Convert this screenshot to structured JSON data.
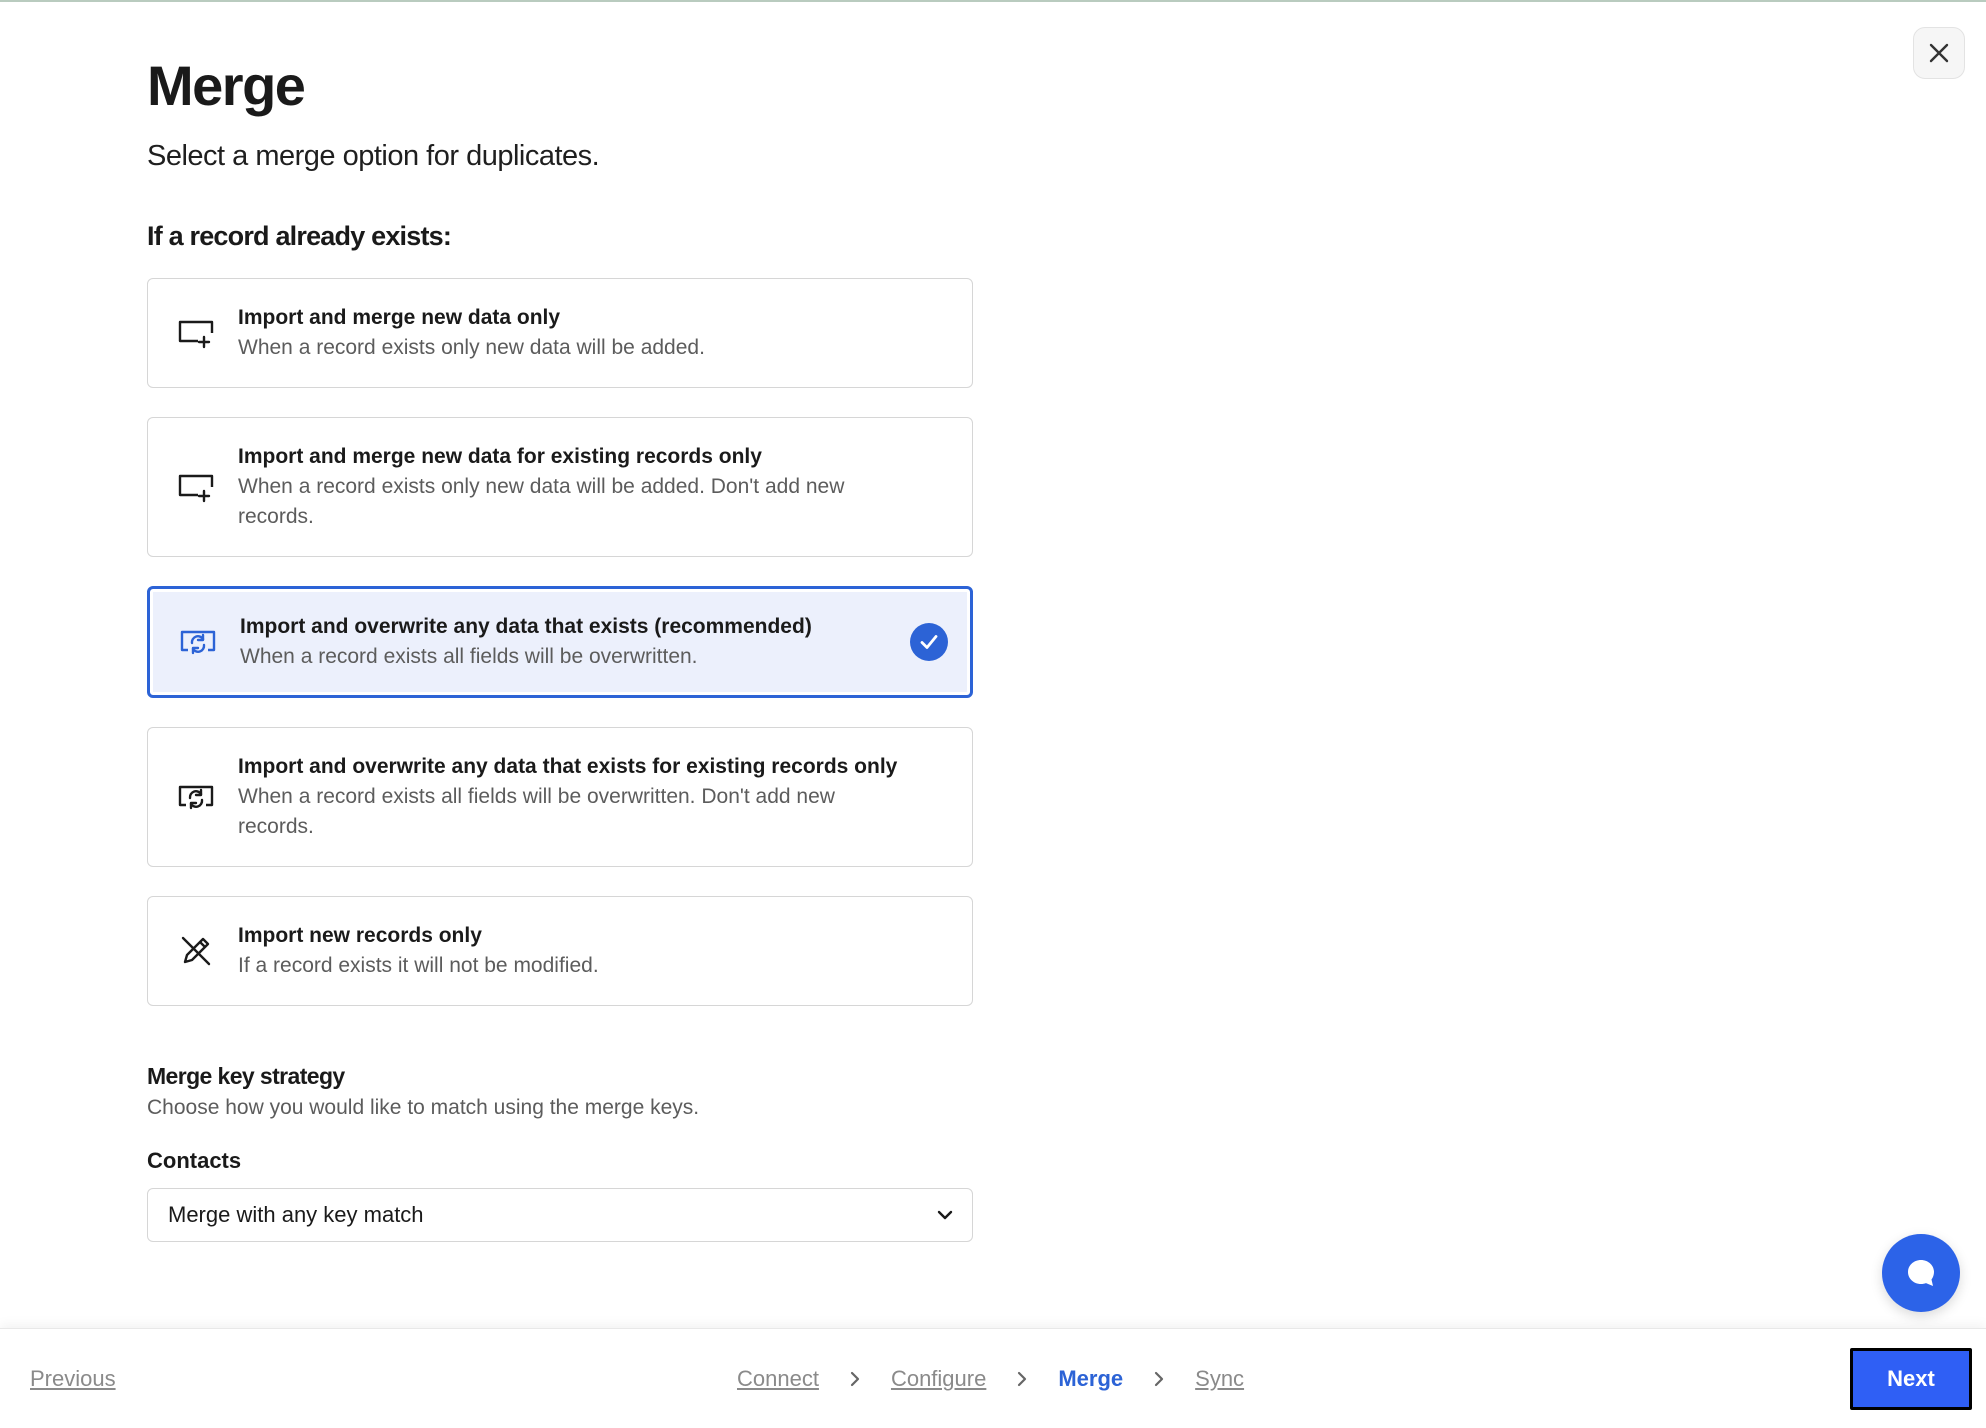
{
  "header": {
    "title": "Merge",
    "subtitle": "Select a merge option for duplicates."
  },
  "close_button": {
    "icon": "close-icon"
  },
  "merge_options": {
    "heading": "If a record already exists:",
    "items": [
      {
        "title": "Import and merge new data only",
        "description": "When a record exists only new data will be added.",
        "icon": "monitor-plus-icon",
        "selected": false
      },
      {
        "title": "Import and merge new data for existing records only",
        "description": "When a record exists only new data will be added. Don't add new records.",
        "icon": "monitor-plus-icon",
        "selected": false
      },
      {
        "title": "Import and overwrite any data that exists (recommended)",
        "description": "When a record exists all fields will be overwritten.",
        "icon": "monitor-refresh-icon",
        "selected": true
      },
      {
        "title": "Import and overwrite any data that exists for existing records only",
        "description": "When a record exists all fields will be overwritten. Don't add new records.",
        "icon": "monitor-refresh-icon",
        "selected": false
      },
      {
        "title": "Import new records only",
        "description": "If a record exists it will not be modified.",
        "icon": "pencil-off-icon",
        "selected": false
      }
    ]
  },
  "merge_key_strategy": {
    "heading": "Merge key strategy",
    "description": "Choose how you would like to match using the merge keys.",
    "contacts_label": "Contacts",
    "selected_value": "Merge with any key match"
  },
  "footer": {
    "previous_label": "Previous",
    "steps": [
      "Connect",
      "Configure",
      "Merge",
      "Sync"
    ],
    "active_step": "Merge",
    "next_label": "Next"
  },
  "colors": {
    "accent": "#2c63d6",
    "selected_bg": "#ecf0fc",
    "next_button": "#2f5ff5",
    "chat_button": "#2c63e8"
  }
}
